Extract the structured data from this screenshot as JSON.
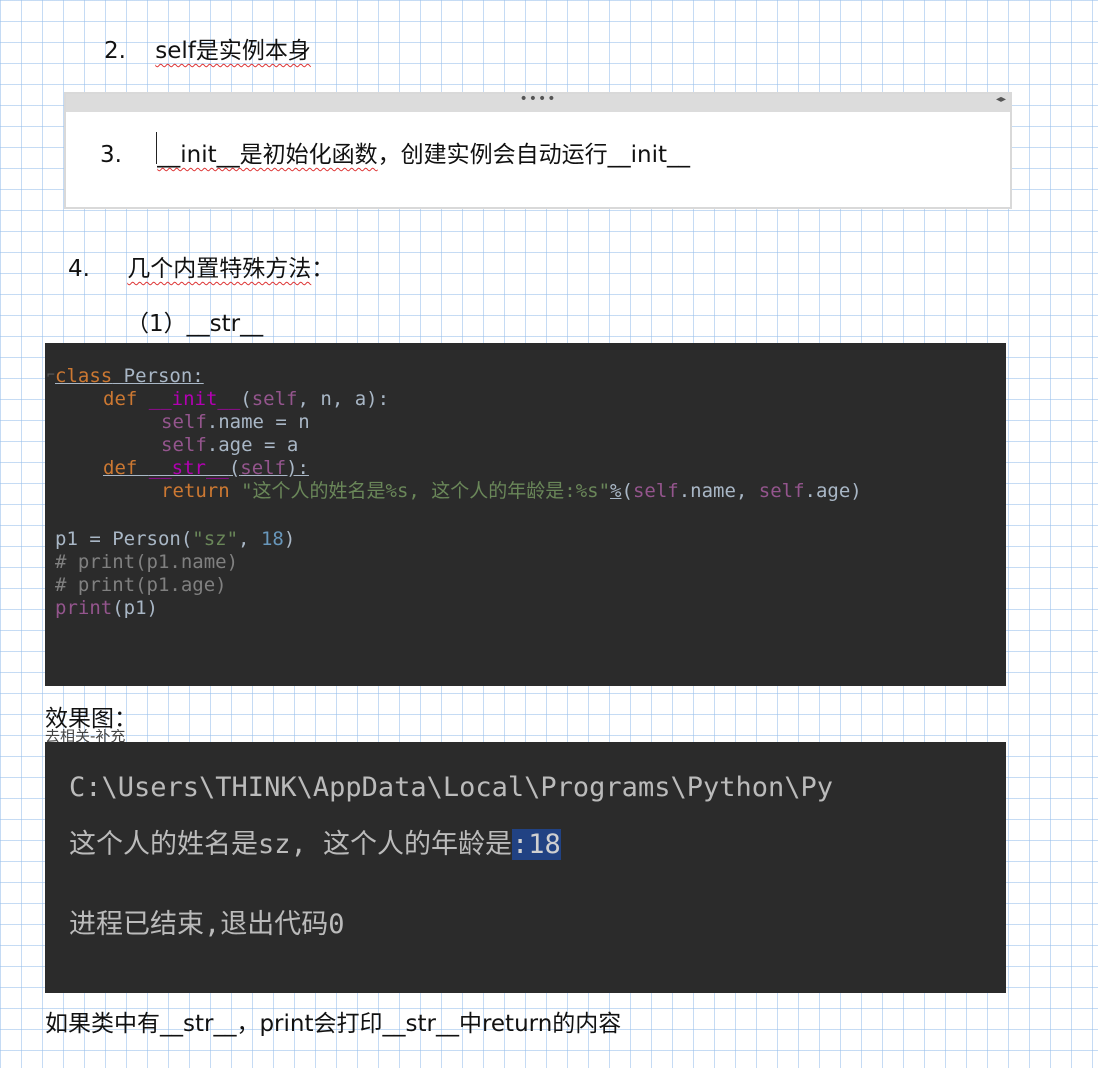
{
  "item2": {
    "number": "2.",
    "text": "self是实例本身"
  },
  "collapse_bar": {
    "dots": "••••",
    "arrows": "◂▸"
  },
  "item3": {
    "number": "3.",
    "part1": "__init__是初始化函数",
    "part2": "，创建实例会自动运行__init__"
  },
  "item4": {
    "number": "4.",
    "title": "几个内置特殊方法",
    "colon": "：",
    "subheading": "（1）__str__"
  },
  "code": {
    "l1_kw": "class",
    "l1_name": " Person:",
    "l2_def": "def ",
    "l2_fn": "__init__",
    "l2_open": "(",
    "l2_self": "self",
    "l2_rest": ", n, a):",
    "l3_self": "self",
    "l3_rest": ".name = n",
    "l4_self": "self",
    "l4_rest": ".age = a",
    "l5_def": "def ",
    "l5_fn": "__str__",
    "l5_open": "(",
    "l5_self": "self",
    "l5_close": "):",
    "l6_ret": "return ",
    "l6_str": "\"这个人的姓名是%s, 这个人的年龄是:%s\"",
    "l6_pct": "%",
    "l6_open": "(",
    "l6_self1": "self",
    "l6_mid": ".name, ",
    "l6_self2": "self",
    "l6_end": ".age)",
    "l7_a": "p1 = Person(",
    "l7_str": "\"sz\"",
    "l7_comma": ", ",
    "l7_num": "18",
    "l7_close": ")",
    "l8": "# print(p1.name)",
    "l9": "# print(p1.age)",
    "l10_fn": "print",
    "l10_rest": "(p1)"
  },
  "effect_label": "效果图：",
  "console": {
    "strip": "去相关-补充",
    "path": "C:\\Users\\THINK\\AppData\\Local\\Programs\\Python\\Py",
    "out_a": "这个人的姓名是sz, 这个人的年龄是",
    "out_b": ":18",
    "exit": "进程已结束,退出代码0"
  },
  "footer": "如果类中有__str__，print会打印__str__中return的内容",
  "colors": {
    "code_bg": "#2b2b2b",
    "grid": "#96bee8",
    "highlight": "#214283"
  }
}
